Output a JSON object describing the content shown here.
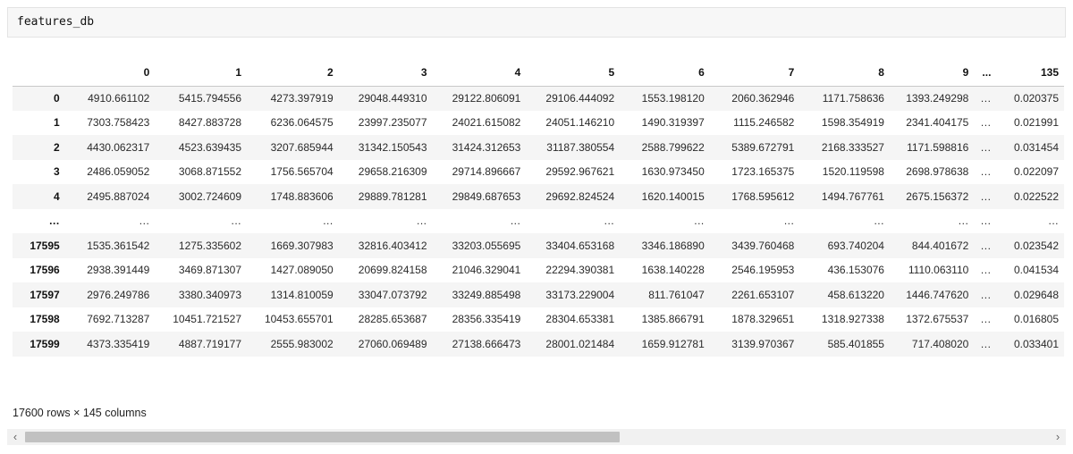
{
  "input_cell": {
    "code": "features_db"
  },
  "table": {
    "columns": [
      "0",
      "1",
      "2",
      "3",
      "4",
      "5",
      "6",
      "7",
      "8",
      "9",
      "...",
      "135"
    ],
    "rows": [
      {
        "index": "0",
        "cells": [
          "4910.661102",
          "5415.794556",
          "4273.397919",
          "29048.449310",
          "29122.806091",
          "29106.444092",
          "1553.198120",
          "2060.362946",
          "1171.758636",
          "1393.249298",
          "...",
          "0.020375"
        ]
      },
      {
        "index": "1",
        "cells": [
          "7303.758423",
          "8427.883728",
          "6236.064575",
          "23997.235077",
          "24021.615082",
          "24051.146210",
          "1490.319397",
          "1115.246582",
          "1598.354919",
          "2341.404175",
          "...",
          "0.021991"
        ]
      },
      {
        "index": "2",
        "cells": [
          "4430.062317",
          "4523.639435",
          "3207.685944",
          "31342.150543",
          "31424.312653",
          "31187.380554",
          "2588.799622",
          "5389.672791",
          "2168.333527",
          "1171.598816",
          "...",
          "0.031454"
        ]
      },
      {
        "index": "3",
        "cells": [
          "2486.059052",
          "3068.871552",
          "1756.565704",
          "29658.216309",
          "29714.896667",
          "29592.967621",
          "1630.973450",
          "1723.165375",
          "1520.119598",
          "2698.978638",
          "...",
          "0.022097"
        ]
      },
      {
        "index": "4",
        "cells": [
          "2495.887024",
          "3002.724609",
          "1748.883606",
          "29889.781281",
          "29849.687653",
          "29692.824524",
          "1620.140015",
          "1768.595612",
          "1494.767761",
          "2675.156372",
          "...",
          "0.022522"
        ]
      },
      {
        "index": "...",
        "cells": [
          "...",
          "...",
          "...",
          "...",
          "...",
          "...",
          "...",
          "...",
          "...",
          "...",
          "...",
          "..."
        ]
      },
      {
        "index": "17595",
        "cells": [
          "1535.361542",
          "1275.335602",
          "1669.307983",
          "32816.403412",
          "33203.055695",
          "33404.653168",
          "3346.186890",
          "3439.760468",
          "693.740204",
          "844.401672",
          "...",
          "0.023542"
        ]
      },
      {
        "index": "17596",
        "cells": [
          "2938.391449",
          "3469.871307",
          "1427.089050",
          "20699.824158",
          "21046.329041",
          "22294.390381",
          "1638.140228",
          "2546.195953",
          "436.153076",
          "1110.063110",
          "...",
          "0.041534"
        ]
      },
      {
        "index": "17597",
        "cells": [
          "2976.249786",
          "3380.340973",
          "1314.810059",
          "33047.073792",
          "33249.885498",
          "33173.229004",
          "811.761047",
          "2261.653107",
          "458.613220",
          "1446.747620",
          "...",
          "0.029648"
        ]
      },
      {
        "index": "17598",
        "cells": [
          "7692.713287",
          "10451.721527",
          "10453.655701",
          "28285.653687",
          "28356.335419",
          "28304.653381",
          "1385.866791",
          "1878.329651",
          "1318.927338",
          "1372.675537",
          "...",
          "0.016805"
        ]
      },
      {
        "index": "17599",
        "cells": [
          "4373.335419",
          "4887.719177",
          "2555.983002",
          "27060.069489",
          "27138.666473",
          "28001.021484",
          "1659.912781",
          "3139.970367",
          "585.401855",
          "717.408020",
          "...",
          "0.033401"
        ]
      }
    ]
  },
  "footer": {
    "shape_text": "17600 rows × 145 columns"
  },
  "scrollbar": {
    "left_arrow": "‹",
    "right_arrow": "›"
  }
}
